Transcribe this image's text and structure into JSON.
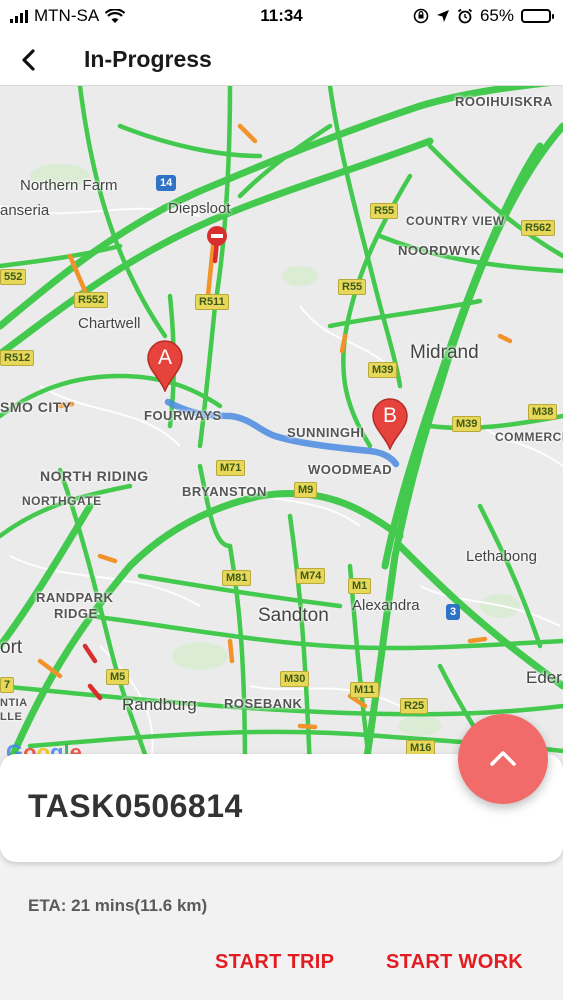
{
  "status_bar": {
    "carrier": "MTN-SA",
    "time": "11:34",
    "battery_percent": "65%",
    "battery_level": 0.65
  },
  "header": {
    "title": "In-Progress",
    "back_icon": "chevron-left-icon"
  },
  "map": {
    "labels": {
      "rooihuiskraal": "ROOIHUISKRA",
      "northern_farm": "Northern Farm",
      "lanseria": "anseria",
      "diepsloot": "Diepsloot",
      "country_view": "COUNTRY VIEW",
      "noordwyk": "NOORDWYK",
      "chartwell": "Chartwell",
      "midrand": "Midrand",
      "cosmo_city": "SMO CITY",
      "fourways": "FOURWAYS",
      "sunninghill": "SUNNINGHI",
      "commercia": "COMMERCI",
      "woodmead": "WOODMEAD",
      "north_riding": "NORTH RIDING",
      "northgate": "NORTHGATE",
      "bryanston": "BRYANSTON",
      "lethabong": "Lethabong",
      "randpark": "RANDPARK",
      "ridge": "RIDGE",
      "sandton": "Sandton",
      "alexandra": "Alexandra",
      "ort": "ort",
      "randburg": "Randburg",
      "rosebank": "ROSEBANK",
      "eden": "Eder",
      "ntia": "NTIA",
      "lle": "LLE"
    },
    "shields": {
      "n14": "14",
      "n3": "3",
      "r55a": "R55",
      "r55b": "R55",
      "r562": "R562",
      "r552a": "R552",
      "r552b": "552",
      "r511": "R511",
      "r512": "R512",
      "m39a": "M39",
      "m39b": "M39",
      "m38": "M38",
      "m71": "M71",
      "m9": "M9",
      "m81": "M81",
      "m74": "M74",
      "m1": "M1",
      "m5": "M5",
      "m30": "M30",
      "m11": "M11",
      "r25": "R25",
      "m16": "M16",
      "m7": "7"
    },
    "marker_a": "A",
    "marker_b": "B",
    "google_logo": "Google"
  },
  "task": {
    "id": "TASK0506814",
    "expand_icon": "chevron-up-icon"
  },
  "eta": "ETA: 21 mins(11.6 km)",
  "actions": {
    "start_trip": "START TRIP",
    "start_work": "START WORK"
  },
  "colors": {
    "traffic_green": "#43c94d",
    "traffic_orange": "#f2922b",
    "route_blue": "#4a8be0",
    "accent_red": "#e21d22",
    "fab_red": "#f26b6b"
  }
}
